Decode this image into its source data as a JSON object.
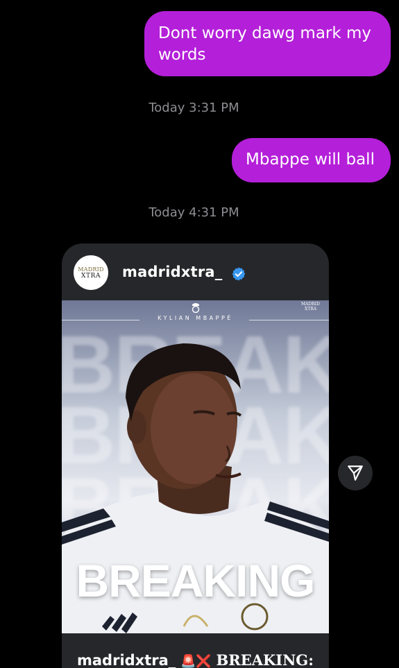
{
  "messages": [
    {
      "text": "Dont worry dawg mark my words"
    },
    {
      "text": "Mbappe will ball"
    }
  ],
  "timestamps": [
    "Today 3:31 PM",
    "Today 4:31 PM"
  ],
  "post": {
    "username": "madridxtra_",
    "avatar_line1": "MADRID",
    "avatar_line2": "XTRA",
    "image_header": "KYLIAN MBAPPÉ",
    "image_brand_top": "MADRID",
    "image_brand_bottom": "XTRA",
    "background_word": "BREAKING",
    "headline": "BREAKING",
    "caption_user": "madridxtra_",
    "caption_emoji": "🚨❌",
    "caption_text": "BREAKING:"
  },
  "colors": {
    "bubble": "#b41fd9",
    "background": "#000000",
    "card": "#26272b",
    "verified": "#3897f0"
  },
  "icons": {
    "verified": "verified-badge-icon",
    "share": "send-share-icon"
  }
}
